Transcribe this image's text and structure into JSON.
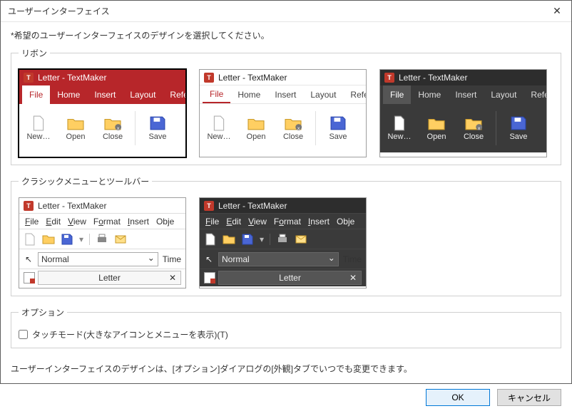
{
  "window": {
    "title": "ユーザーインターフェイス"
  },
  "prompt": "*希望のユーザーインターフェイスのデザインを選択してください。",
  "groups": {
    "ribbon": "リボン",
    "classic": "クラシックメニューとツールバー",
    "options": "オプション"
  },
  "preview": {
    "app_title": "Letter - TextMaker",
    "tabs": {
      "file": "File",
      "home": "Home",
      "insert": "Insert",
      "layout": "Layout",
      "refe": "Refe"
    },
    "btns": {
      "new": "New…",
      "open": "Open",
      "close": "Close",
      "save": "Save"
    },
    "menu": {
      "file": "File",
      "edit": "Edit",
      "view": "View",
      "format": "Format",
      "insert": "Insert",
      "obje": "Obje"
    },
    "style_select": "Normal",
    "tab_label": "Letter",
    "sidelabel": "Time"
  },
  "options": {
    "touch_mode": "タッチモード(大きなアイコンとメニューを表示)(T)"
  },
  "info": "ユーザーインターフェイスのデザインは、[オプション]ダイアログの[外観]タブでいつでも変更できます。",
  "buttons": {
    "ok": "OK",
    "cancel": "キャンセル"
  }
}
